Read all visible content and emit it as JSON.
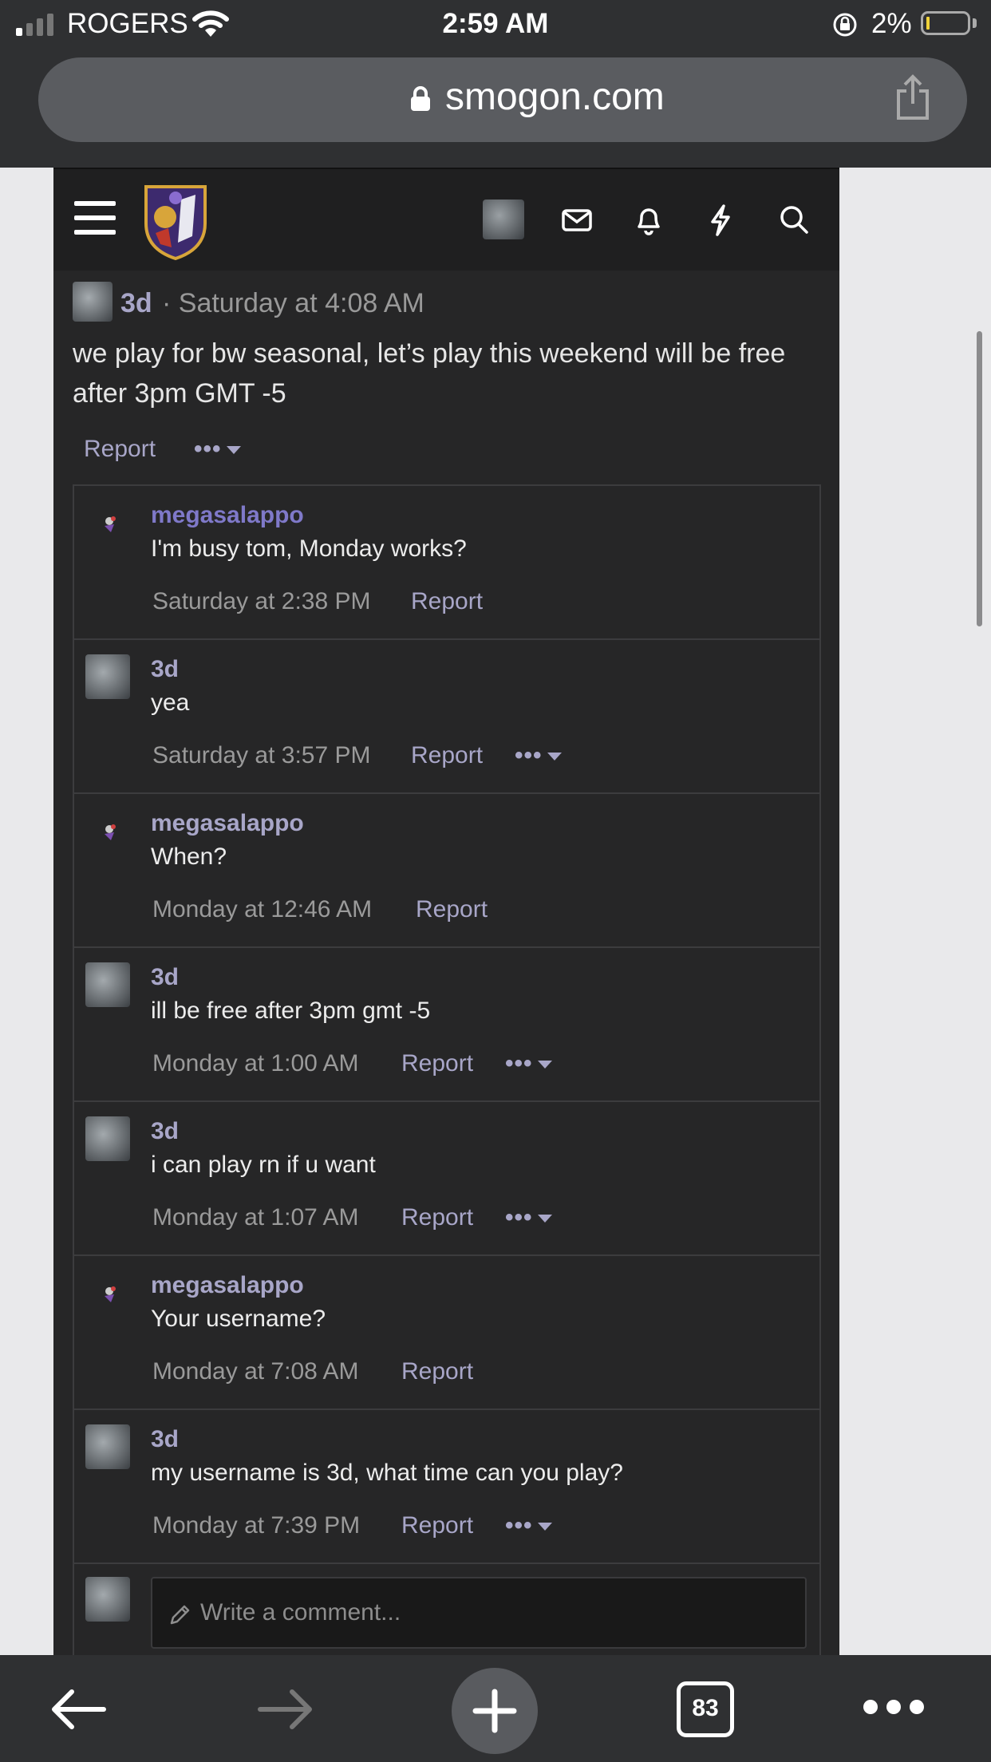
{
  "status_bar": {
    "carrier": "ROGERS",
    "time": "2:59 AM",
    "battery_percent": "2%",
    "battery_level": 0.02
  },
  "url_bar": {
    "domain": "smogon.com"
  },
  "header": {
    "icons": [
      "menu-icon",
      "smogon-logo",
      "user-avatar",
      "mail-icon",
      "bell-icon",
      "bolt-icon",
      "search-icon"
    ]
  },
  "post": {
    "author": "3d",
    "time": "· Saturday at 4:08 AM",
    "body": "we play for bw seasonal, let’s play this weekend will be free after 3pm GMT -5",
    "report": "Report",
    "more": "•••"
  },
  "comments": [
    {
      "author": "megasalappo",
      "text": "I'm busy tom, Monday works?",
      "time": "Saturday at 2:38 PM",
      "report": "Report",
      "more": ""
    },
    {
      "author": "3d",
      "text": "yea",
      "time": "Saturday at 3:57 PM",
      "report": "Report",
      "more": "•••"
    },
    {
      "author": "megasalappo",
      "text": "When?",
      "time": "Monday at 12:46 AM",
      "report": "Report",
      "more": ""
    },
    {
      "author": "3d",
      "text": "ill be free after 3pm gmt -5",
      "time": "Monday at 1:00 AM",
      "report": "Report",
      "more": "•••"
    },
    {
      "author": "3d",
      "text": "i can play rn if u want",
      "time": "Monday at 1:07 AM",
      "report": "Report",
      "more": "•••"
    },
    {
      "author": "megasalappo",
      "text": "Your username?",
      "time": "Monday at 7:08 AM",
      "report": "Report",
      "more": ""
    },
    {
      "author": "3d",
      "text": "my username is 3d, what time can you play?",
      "time": "Monday at 7:39 PM",
      "report": "Report",
      "more": "•••"
    }
  ],
  "reply": {
    "placeholder": "Write a comment..."
  },
  "toolbar": {
    "tab_count": "83"
  }
}
